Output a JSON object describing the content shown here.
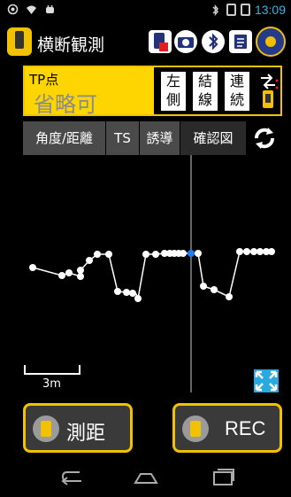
{
  "status": {
    "time": "13:09",
    "signal_a": "6"
  },
  "app": {
    "title": "横断観測",
    "icons": [
      "app-logo-icon",
      "device-sync-icon",
      "camera-icon",
      "bluetooth-icon",
      "list-icon",
      "settings-globe-icon"
    ]
  },
  "tp": {
    "label": "TP点",
    "value": "省略可",
    "buttons": [
      {
        "line1": "左",
        "line2": "側"
      },
      {
        "line1": "結",
        "line2": "線"
      },
      {
        "line1": "連",
        "line2": "続"
      }
    ]
  },
  "tabs": [
    "角度/距離",
    "TS",
    "誘導",
    "確認図"
  ],
  "active_tab": "確認図",
  "plot": {
    "scale_label": "3m",
    "accent_point_color": "#1e7bff"
  },
  "buttons": {
    "measure_label": "測距",
    "rec_label": "REC"
  },
  "colors": {
    "accent_yellow": "#f2c200",
    "field_yellow": "#ffd500",
    "blue": "#2aa8e0"
  }
}
